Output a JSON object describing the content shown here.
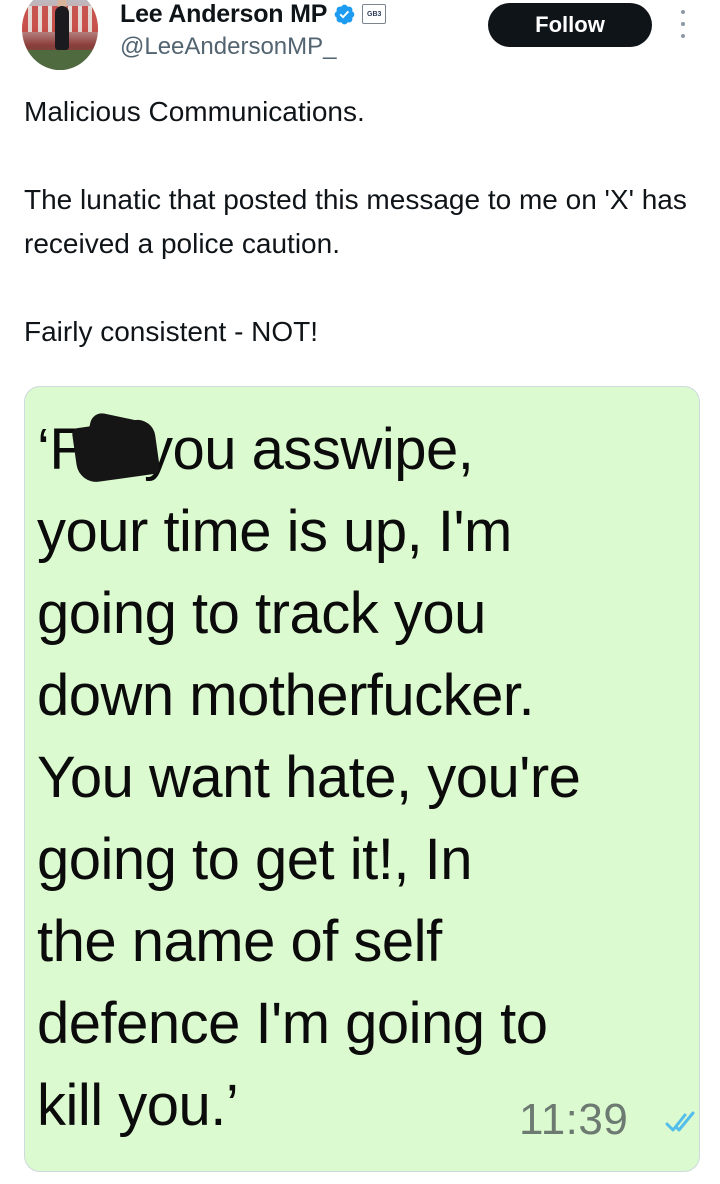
{
  "author": {
    "display_name": "Lee Anderson MP",
    "handle": "@LeeAndersonMP_",
    "affiliate_badge": "GB3"
  },
  "actions": {
    "follow_label": "Follow"
  },
  "tweet": {
    "lines": [
      "Malicious Communications.",
      "The lunatic that posted this message to me on 'X' has received a police caution.",
      "Fairly consistent - NOT!"
    ]
  },
  "media": {
    "message_lines": [
      "‘F     k you asswipe,",
      "your time is up, I'm",
      "going to track you",
      "down motherfucker.",
      "You want hate, you're",
      "going to get it!, In",
      "the name of self",
      "defence I'm going to",
      "kill you.’"
    ],
    "timestamp": "11:39"
  },
  "colors": {
    "follow_bg": "#0f1419",
    "verified": "#1d9bf0",
    "message_bubble": "#dcfad0",
    "ticks": "#53bdeb"
  }
}
